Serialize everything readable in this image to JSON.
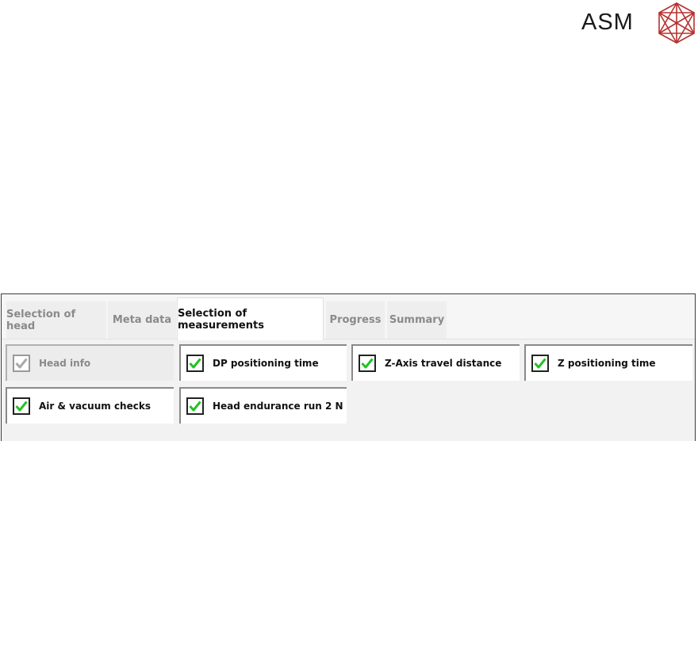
{
  "logo": {
    "text": "ASM"
  },
  "tabs": [
    {
      "label": "Selection of head",
      "active": false
    },
    {
      "label": "Meta data",
      "active": false
    },
    {
      "label": "Selection of measurements",
      "active": true
    },
    {
      "label": "Progress",
      "active": false
    },
    {
      "label": "Summary",
      "active": false
    }
  ],
  "measurements": [
    {
      "label": "Head info",
      "checked": true,
      "enabled": false
    },
    {
      "label": "DP positioning time",
      "checked": true,
      "enabled": true
    },
    {
      "label": "Z-Axis travel distance",
      "checked": true,
      "enabled": true
    },
    {
      "label": "Z positioning time",
      "checked": true,
      "enabled": true
    },
    {
      "label": "Air & vacuum checks",
      "checked": true,
      "enabled": true
    },
    {
      "label": "Head endurance run 2 N",
      "checked": true,
      "enabled": true
    }
  ],
  "colors": {
    "logo_mark": "#b5322e",
    "check_green": "#22c322",
    "check_gray": "#a9a9a9"
  }
}
